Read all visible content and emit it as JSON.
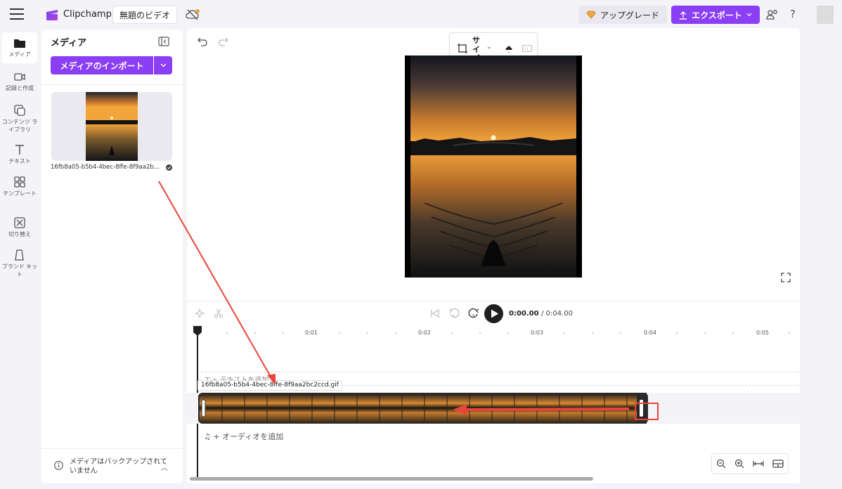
{
  "app": {
    "brand": "Clipchamp",
    "project_title": "無題のビデオ",
    "upgrade_label": "アップグレード",
    "export_label": "エクスポート",
    "help_label": "?",
    "accent_color": "#8b3ff5"
  },
  "rail": {
    "items": [
      {
        "label": "メディア",
        "icon": "folder-icon",
        "active": true
      },
      {
        "label": "記録と作成",
        "icon": "camera-icon"
      },
      {
        "label": "コンテンツ ライブラリ",
        "icon": "library-icon"
      },
      {
        "label": "テキスト",
        "icon": "text-icon"
      },
      {
        "label": "テンプレート",
        "icon": "template-icon"
      },
      {
        "label": "切り替え",
        "icon": "transition-icon"
      },
      {
        "label": "ブランド キット",
        "icon": "brand-kit-icon"
      }
    ]
  },
  "media": {
    "title": "メディア",
    "import_label": "メディアのインポート",
    "file_name": "16fb8a05-b5b4-4bec-8ffe-8f9aa2b...",
    "backup_message": "メディアはバックアップされていません"
  },
  "preview": {
    "size_label": "サイズ"
  },
  "timeline": {
    "current_time": "0:00.00",
    "duration": "/ 0:04.00",
    "ticks": [
      "0:01",
      "0:02",
      "0:03",
      "0:04",
      "0:05"
    ],
    "text_track_label": "T  + テキストを追加",
    "clip_label": "16fb8a05-b5b4-4bec-8ffe-8f9aa2bc2ccd.gif",
    "audio_track_label": "♫  + オーディオを追加"
  },
  "annotation": {
    "arrow_color": "#e8453c"
  }
}
